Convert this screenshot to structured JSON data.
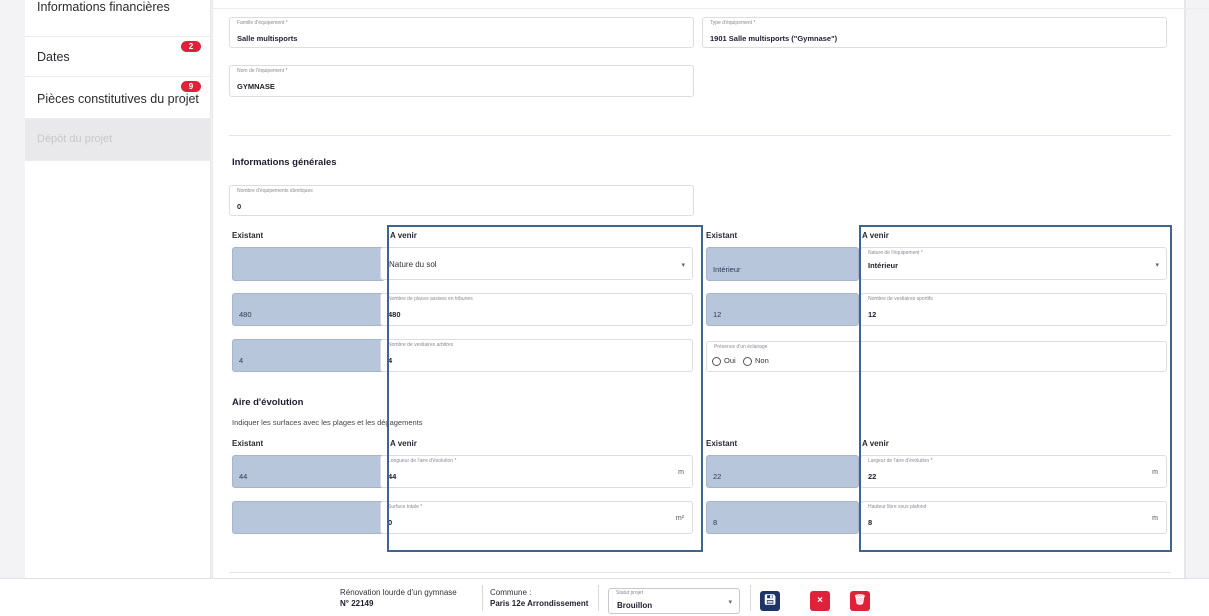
{
  "sidebar": {
    "items": [
      {
        "label": "Informations financières"
      },
      {
        "label": "Dates",
        "badge": "2"
      },
      {
        "label": "Pièces constitutives du projet",
        "badge": "9"
      },
      {
        "label": "Dépôt du projet"
      }
    ]
  },
  "equipment": {
    "famille": {
      "label": "Famille d'équipement *",
      "value": "Salle multisports"
    },
    "type": {
      "label": "Type d'équipement *",
      "value": "1901 Salle multisports (\"Gymnase\")"
    },
    "nom": {
      "label": "Nom de l'équipement *",
      "value": "GYMNASE"
    }
  },
  "general": {
    "title": "Informations générales",
    "nb_identiques": {
      "label": "Nombre d'équipements identiques",
      "value": "0"
    },
    "col_existant": "Existant",
    "col_avenir": "A venir",
    "nature_sol": {
      "existant": "",
      "placeholder": "Nature du sol"
    },
    "places": {
      "existant": "480",
      "label": "Nombre de places assises en tribunes",
      "value": "480"
    },
    "vestiaires_arbitres": {
      "existant": "4",
      "label": "Nombre de vestiaires arbitres",
      "value": "4"
    },
    "nature_equipement": {
      "existant": "Intérieur",
      "label": "Nature de l'équipement *",
      "value": "Intérieur"
    },
    "vestiaires_sportifs": {
      "existant": "12",
      "label": "Nombre de vestiaires sportifs",
      "value": "12"
    },
    "eclairage": {
      "label": "Présence d'un éclairage",
      "oui": "Oui",
      "non": "Non"
    }
  },
  "aire": {
    "title": "Aire d'évolution",
    "hint": "Indiquer les surfaces avec les plages et les dégagements",
    "longueur": {
      "existant": "44",
      "label": "Longueur de l'aire d'évolution *",
      "value": "44",
      "unit": "m"
    },
    "surface": {
      "existant": "",
      "label": "Surface totale *",
      "value": "0",
      "unit": "m²"
    },
    "largeur": {
      "existant": "22",
      "label": "Largeur de l'aire d'évolution *",
      "value": "22",
      "unit": "m"
    },
    "hauteur": {
      "existant": "8",
      "label": "Hauteur libre sous plafond",
      "value": "8",
      "unit": "m"
    }
  },
  "footer": {
    "project_title": "Rénovation lourde d'un gymnase",
    "project_number": "N° 22149",
    "commune_label": "Commune :",
    "commune_value": "Paris 12e Arrondissement",
    "status_label": "Statut projet",
    "status_value": "Brouillon"
  },
  "colors": {
    "accent": "#1f3466",
    "danger": "#e0213a",
    "existing_field": "#b8c6dc",
    "highlight_border": "#3e6490"
  }
}
